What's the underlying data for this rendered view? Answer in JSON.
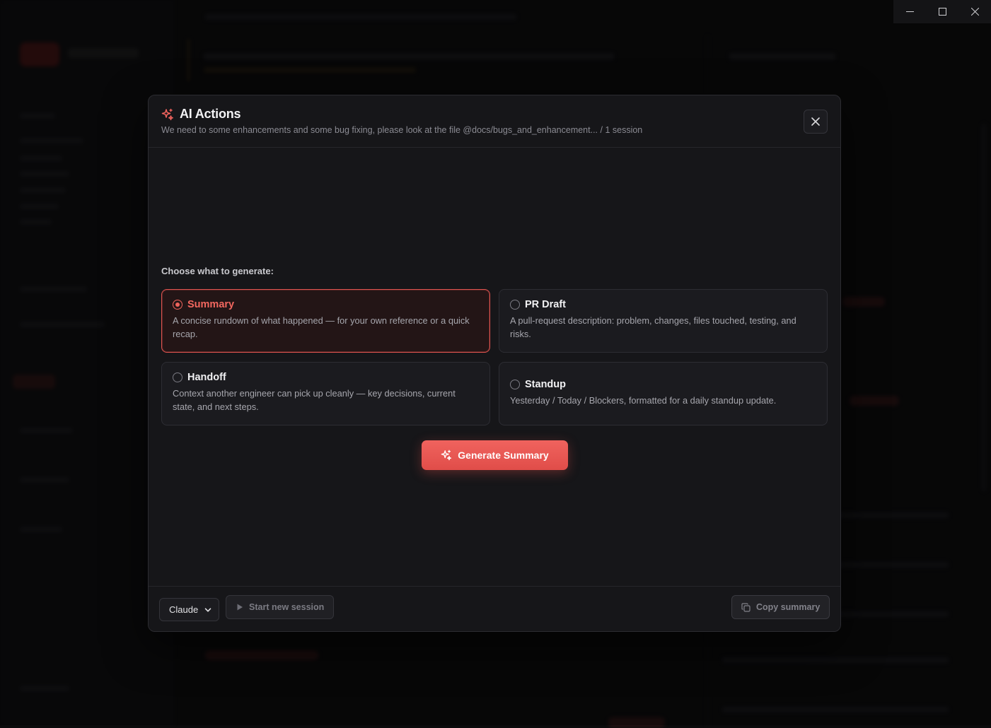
{
  "window": {
    "controls": [
      "minimize",
      "maximize",
      "close"
    ]
  },
  "modal": {
    "title": "AI Actions",
    "subtitle": "We need to some enhancements and some bug fixing, please look at the file @docs/bugs_and_enhancement... / 1 session",
    "choose_label": "Choose what to generate:",
    "options": [
      {
        "id": "summary",
        "title": "Summary",
        "description": "A concise rundown of what happened — for your own reference or a quick recap.",
        "selected": true
      },
      {
        "id": "pr-draft",
        "title": "PR Draft",
        "description": "A pull-request description: problem, changes, files touched, testing, and risks.",
        "selected": false
      },
      {
        "id": "handoff",
        "title": "Handoff",
        "description": "Context another engineer can pick up cleanly — key decisions, current state, and next steps.",
        "selected": false
      },
      {
        "id": "standup",
        "title": "Standup",
        "description": "Yesterday / Today / Blockers, formatted for a daily standup update.",
        "selected": false
      }
    ],
    "generate_label": "Generate Summary",
    "footer": {
      "model_select": "Claude",
      "start_session_label": "Start new session",
      "copy_label": "Copy summary"
    }
  },
  "colors": {
    "accent": "#f0635e",
    "modal_bg": "#161619",
    "page_bg": "#0b0b0c"
  }
}
